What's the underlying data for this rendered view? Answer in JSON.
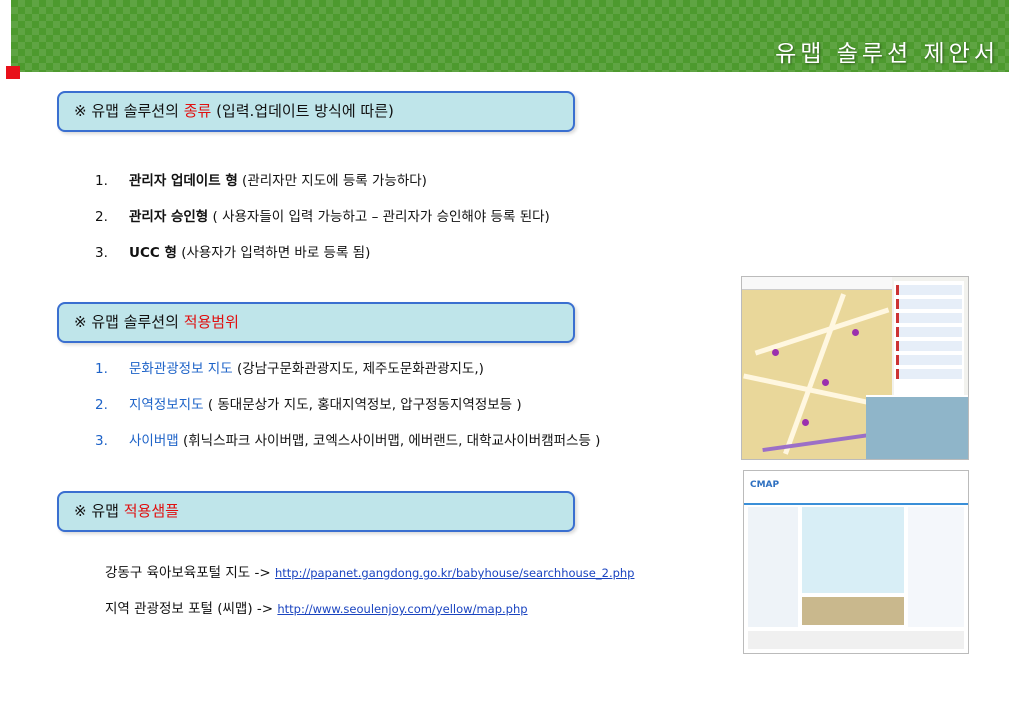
{
  "header": {
    "title": "유맵 솔루션 제안서"
  },
  "section1": {
    "prefix": "※ 유맵 솔루션의 ",
    "highlight": "종류",
    "suffix": " (입력.업데이트 방식에 따른)",
    "items": [
      {
        "num": "1.",
        "bold": "관리자 업데이트 형",
        "rest": " (관리자만 지도에 등록 가능하다)"
      },
      {
        "num": "2.",
        "bold": "관리자 승인형",
        "rest": " ( 사용자들이 입력 가능하고 – 관리자가 승인해야 등록 된다)"
      },
      {
        "num": "3.",
        "bold": "UCC 형",
        "rest": " (사용자가 입력하면 바로 등록 됨)"
      }
    ]
  },
  "section2": {
    "prefix": "※ 유맵 솔루션의 ",
    "highlight": "적용범위",
    "items": [
      {
        "num": "1.",
        "name": "문화관광정보 지도",
        "rest": " (강남구문화관광지도, 제주도문화관광지도,)"
      },
      {
        "num": "2.",
        "name": "지역정보지도",
        "rest": " ( 동대문상가 지도, 홍대지역정보, 압구정동지역정보등 )"
      },
      {
        "num": "3.",
        "name": "사이버맵",
        "rest": " (휘닉스파크 사이버맵, 코엑스사이버맵, 에버랜드, 대학교사이버캠퍼스등 )"
      }
    ]
  },
  "section3": {
    "prefix": "※ 유맵 ",
    "highlight": "적용샘플",
    "samples": [
      {
        "label": "강동구 육아보육포털 지도  -> ",
        "url": "http://papanet.gangdong.go.kr/babyhouse/searchhouse_2.php"
      },
      {
        "label": "지역 관광정보 포털 (씨맵) -> ",
        "url": "http://www.seoulenjoy.com/yellow/map.php"
      }
    ]
  },
  "thumbnails": {
    "map2_logo": "CMAP"
  },
  "colors": {
    "accent_red": "#e01010",
    "link_blue": "#1e63c8",
    "header_green": "#4d9a2e",
    "box_fill": "#bfe5ea",
    "box_border": "#3a6fd0"
  }
}
